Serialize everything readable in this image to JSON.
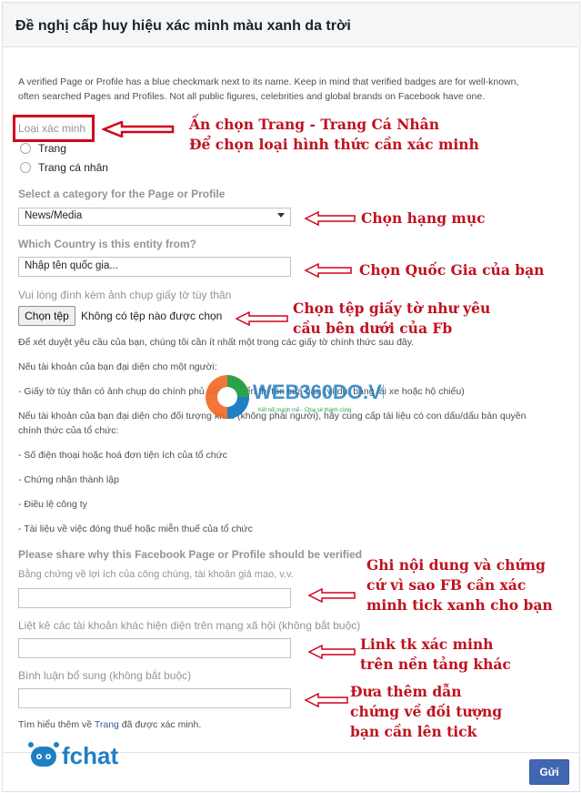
{
  "header": {
    "title": "Đề nghị cấp huy hiệu xác minh màu xanh da trời"
  },
  "intro": "A verified Page or Profile has a blue checkmark next to its name. Keep in mind that verified badges are for well-known, often searched Pages and Profiles. Not all public figures, celebrities and global brands on Facebook have one.",
  "verification_type": {
    "label": "Loại xác minh",
    "options": [
      "Trang",
      "Trang cá nhân"
    ]
  },
  "category": {
    "label": "Select a category for the Page or Profile",
    "value": "News/Media"
  },
  "country": {
    "label": "Which Country is this entity from?",
    "placeholder": "Nhập tên quốc gia..."
  },
  "id_attachment": {
    "label": "Vui lòng đính kèm ảnh chụp giấy tờ tùy thân",
    "button": "Chọn tệp",
    "status": "Không có tệp nào được chọn"
  },
  "requirements": {
    "line1": "Để xét duyệt yêu cầu của bạn, chúng tôi cần ít nhất một trong các giấy tờ chính thức sau đây.",
    "line2": "Nếu tài khoản của bạn đại diện cho một người:",
    "line3": "- Giấy tờ tùy thân có ảnh chụp do chính phủ cấp và hiển thị tên của bạn (ví dụ: bằng lái xe hoặc hộ chiếu)",
    "line4a": "Nếu tài khoản của bạn đại diện cho đối tượng khác (không phải người), hãy cung cấp tài liệu có con dấu/dấu bản quyền",
    "line4b": "chính thức của tổ chức:",
    "items": [
      "- Số điện thoại hoặc hoá đơn tiện ích của tổ chức",
      "- Chứng nhận thành lập",
      "- Điều lệ công ty",
      "- Tài liệu về việc đóng thuế hoặc miễn thuế của tổ chức"
    ]
  },
  "share_why": {
    "label": "Please share why this Facebook Page or Profile should be verified",
    "sublabel": "Bằng chứng về lợi ích của công chúng, tài khoản giả mạo, v.v."
  },
  "other_accounts": {
    "label": "Liệt kê các tài khoản khác hiện diện trên mạng xã hội (không bắt buộc)"
  },
  "comments": {
    "label": "Bình luận bổ sung (không bắt buộc)"
  },
  "learn_more": {
    "prefix": "Tìm hiểu thêm về ",
    "link": "Trang",
    "suffix": " đã được xác minh."
  },
  "send_button": "Gửi",
  "annotations": {
    "a1_line1": "Ấn chọn Trang - Trang Cá Nhân",
    "a1_line2": "Để chọn loại hình thức cần xác minh",
    "a2": "Chọn hạng mục",
    "a3": "Chọn Quốc Gia của bạn",
    "a4_line1": "Chọn tệp giấy tờ như yêu",
    "a4_line2": "cầu bên dưới của Fb",
    "a5_line1": "Ghi nội dung và chứng",
    "a5_line2": "cứ vì sao FB cần xác",
    "a5_line3": "minh tick xanh cho bạn",
    "a6_line1": "Link tk xác minh",
    "a6_line2": "trên nền tảng khác",
    "a7_line1": "Đưa thêm dẫn",
    "a7_line2": "chứng về đối tượng",
    "a7_line3": "bạn cần lên tick"
  },
  "watermark": {
    "brand": "WEB360DO.VN",
    "tagline": "Kết nối mạnh mẽ - Chia sẻ thành công"
  },
  "logo": {
    "text": "fchat"
  },
  "colors": {
    "annotation_red": "#c0121f",
    "button_blue": "#4267b2",
    "link_blue": "#365899"
  }
}
